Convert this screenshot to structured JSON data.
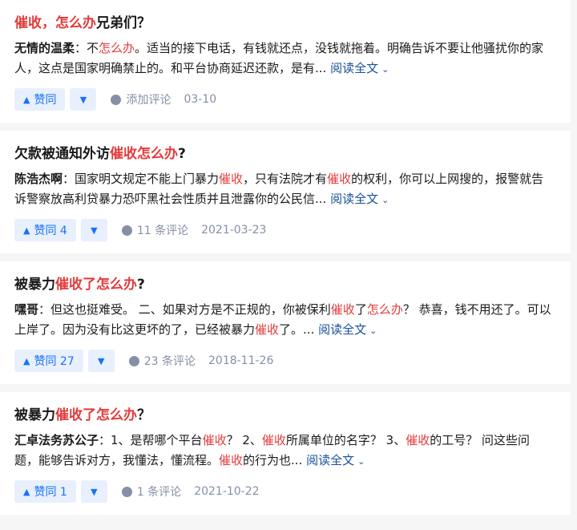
{
  "ui": {
    "read_more": "阅读全文",
    "vote_label": "赞同"
  },
  "items": [
    {
      "title": [
        {
          "t": "催收，怎么办",
          "hl": true
        },
        {
          "t": "兄弟们？",
          "hl": false
        }
      ],
      "author": "无情的温柔",
      "excerpt": [
        {
          "t": "：不",
          "hl": false
        },
        {
          "t": "怎么办",
          "hl": true
        },
        {
          "t": "。适当的接下电话，有钱就还点，没钱就拖着。明确告诉不要让他骚扰你的家人，这点是国家明确禁止的。和平台协商延迟还款，是有... ",
          "hl": false
        }
      ],
      "votes": "赞同",
      "comments": "添加评论",
      "date": "03-10"
    },
    {
      "title": [
        {
          "t": "欠款被通知外访",
          "hl": false
        },
        {
          "t": "催收怎么办",
          "hl": true
        },
        {
          "t": "?",
          "hl": false
        }
      ],
      "author": "陈浩杰啊",
      "excerpt": [
        {
          "t": "：国家明文规定不能上门暴力",
          "hl": false
        },
        {
          "t": "催收",
          "hl": true
        },
        {
          "t": "，只有法院才有",
          "hl": false
        },
        {
          "t": "催收",
          "hl": true
        },
        {
          "t": "的权利，你可以上网搜的，报警就告诉警察放高利贷暴力恐吓黑社会性质并且泄露你的公民信... ",
          "hl": false
        }
      ],
      "votes": "赞同 4",
      "comments": "11 条评论",
      "date": "2021-03-23"
    },
    {
      "title": [
        {
          "t": "被暴力",
          "hl": false
        },
        {
          "t": "催收了怎么办",
          "hl": true
        },
        {
          "t": "?",
          "hl": false
        }
      ],
      "author": "嘿哥",
      "excerpt": [
        {
          "t": "：但这也挺难受。 二、如果对方是不正规的，你被保利",
          "hl": false
        },
        {
          "t": "催收",
          "hl": true
        },
        {
          "t": "了",
          "hl": false
        },
        {
          "t": "怎么办",
          "hl": true
        },
        {
          "t": "？ 恭喜，钱不用还了。可以上岸了。因为没有比这更坏的了，已经被暴力",
          "hl": false
        },
        {
          "t": "催收",
          "hl": true
        },
        {
          "t": "了。... ",
          "hl": false
        }
      ],
      "votes": "赞同 27",
      "comments": "23 条评论",
      "date": "2018-11-26"
    },
    {
      "title": [
        {
          "t": "被暴力",
          "hl": false
        },
        {
          "t": "催收了怎么办",
          "hl": true
        },
        {
          "t": "？",
          "hl": false
        }
      ],
      "author": "汇卓法务苏公子",
      "excerpt": [
        {
          "t": "：1、是帮哪个平台",
          "hl": false
        },
        {
          "t": "催收",
          "hl": true
        },
        {
          "t": "？ 2、",
          "hl": false
        },
        {
          "t": "催收",
          "hl": true
        },
        {
          "t": "所属单位的名字？ 3、",
          "hl": false
        },
        {
          "t": "催收",
          "hl": true
        },
        {
          "t": "的工号？ 问这些问题，能够告诉对方，我懂法，懂流程。",
          "hl": false
        },
        {
          "t": "催收",
          "hl": true
        },
        {
          "t": "的行为也... ",
          "hl": false
        }
      ],
      "votes": "赞同 1",
      "comments": "1 条评论",
      "date": "2021-10-22"
    }
  ]
}
